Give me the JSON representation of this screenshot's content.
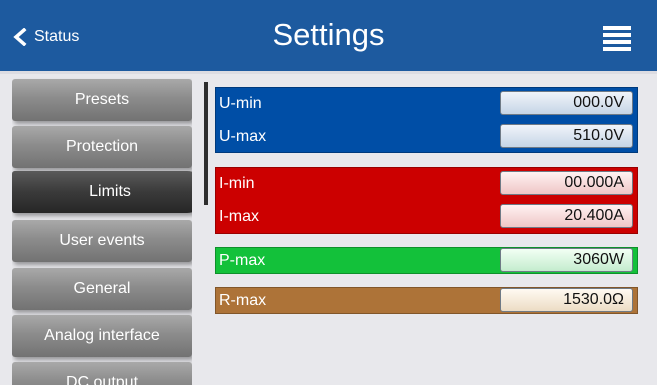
{
  "header": {
    "back_label": "Status",
    "title": "Settings"
  },
  "sidebar": {
    "items": [
      {
        "label": "Presets"
      },
      {
        "label": "Protection"
      },
      {
        "label": "Limits",
        "active": true
      },
      {
        "label": "User events"
      },
      {
        "label": "General"
      },
      {
        "label": "Analog interface"
      },
      {
        "label": "DC output"
      }
    ]
  },
  "limits": {
    "voltage": {
      "color": "#004ea6",
      "min_label": "U-min",
      "min_value": "000.0V",
      "max_label": "U-max",
      "max_value": "510.0V"
    },
    "current": {
      "color": "#cc0000",
      "min_label": "I-min",
      "min_value": "00.000A",
      "max_label": "I-max",
      "max_value": "20.400A"
    },
    "power": {
      "color": "#13c13a",
      "max_label": "P-max",
      "max_value": "3060W"
    },
    "resistance": {
      "color": "#ad7338",
      "max_label": "R-max",
      "max_value": "1530.0Ω"
    }
  },
  "icons": {
    "back": "chevron-left-icon",
    "menu": "hamburger-menu-icon"
  },
  "colors": {
    "header": "#1d5a9f",
    "background": "#e8e8ec"
  }
}
